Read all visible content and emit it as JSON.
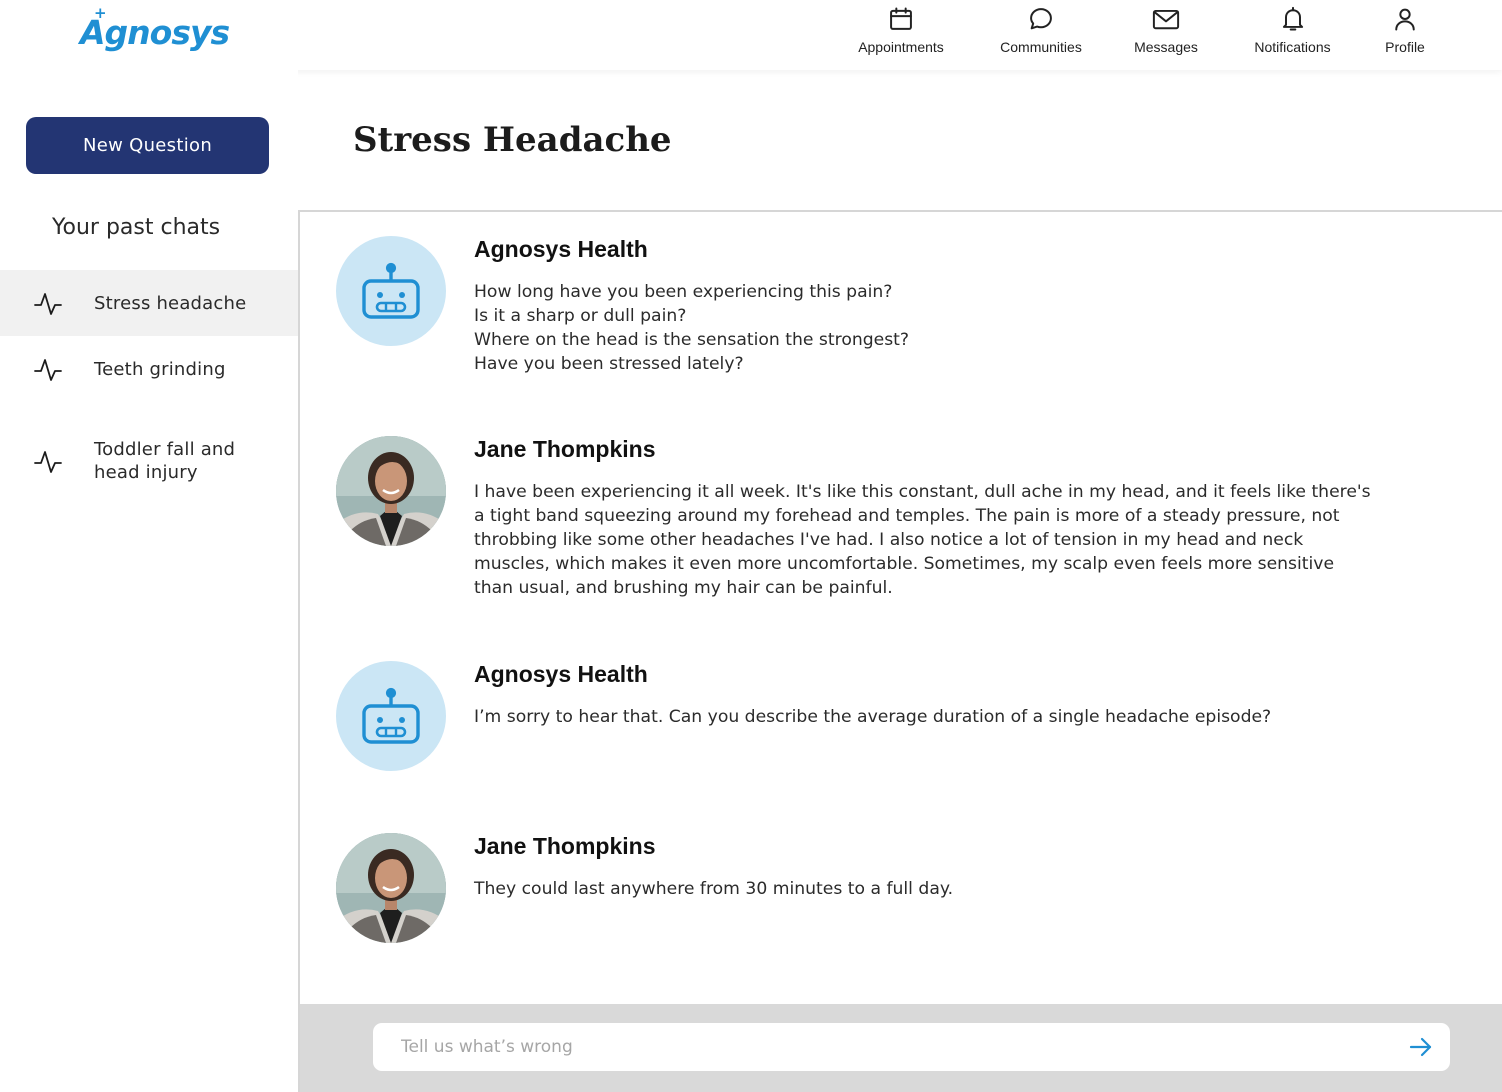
{
  "app": {
    "logo_text": "Agnosys",
    "logo_mark": "+"
  },
  "nav": {
    "items": [
      {
        "label": "Appointments",
        "icon": "calendar-icon"
      },
      {
        "label": "Communities",
        "icon": "chat-bubble-icon"
      },
      {
        "label": "Messages",
        "icon": "envelope-icon"
      },
      {
        "label": "Notifications",
        "icon": "bell-icon"
      },
      {
        "label": "Profile",
        "icon": "user-icon"
      }
    ]
  },
  "sidebar": {
    "new_question_label": "New Question",
    "past_chats_title": "Your past chats",
    "chats": [
      {
        "label": "Stress headache",
        "icon": "pulse-icon",
        "active": true
      },
      {
        "label": "Teeth grinding",
        "icon": "pulse-icon",
        "active": false
      },
      {
        "label": "Toddler fall and head injury",
        "icon": "pulse-icon",
        "active": false
      }
    ]
  },
  "conversation": {
    "title": "Stress Headache",
    "messages": [
      {
        "sender": "Agnosys Health",
        "avatar": "robot-icon",
        "lines": [
          "How long have you been experiencing this pain?",
          "Is it a sharp or dull pain?",
          "Where on the head is the sensation the strongest?",
          "Have you been stressed lately?"
        ]
      },
      {
        "sender": "Jane Thompkins",
        "avatar": "user-photo",
        "lines": [
          "I have been experiencing it all week. It's like this constant, dull ache in my head, and it feels like there's",
          "a tight band squeezing around my forehead and temples. The pain is more of a steady pressure, not",
          "throbbing like some other headaches I've had. I also notice a lot of tension in my head and neck",
          "muscles, which makes it even more uncomfortable. Sometimes, my scalp even feels more sensitive",
          "than usual, and brushing my hair can be painful."
        ]
      },
      {
        "sender": "Agnosys Health",
        "avatar": "robot-icon",
        "lines": [
          "I’m sorry to hear that. Can you describe the average duration of a single headache episode?"
        ]
      },
      {
        "sender": "Jane Thompkins",
        "avatar": "user-photo",
        "lines": [
          "They could last anywhere from 30 minutes to a full day."
        ]
      }
    ]
  },
  "composer": {
    "placeholder": "Tell us what’s wrong",
    "send_icon": "arrow-right-icon"
  },
  "colors": {
    "brand_blue": "#1f8fd3",
    "button_navy": "#233573",
    "bot_avatar_bg": "#cbe6f5",
    "composer_bg": "#d9d9d9"
  }
}
